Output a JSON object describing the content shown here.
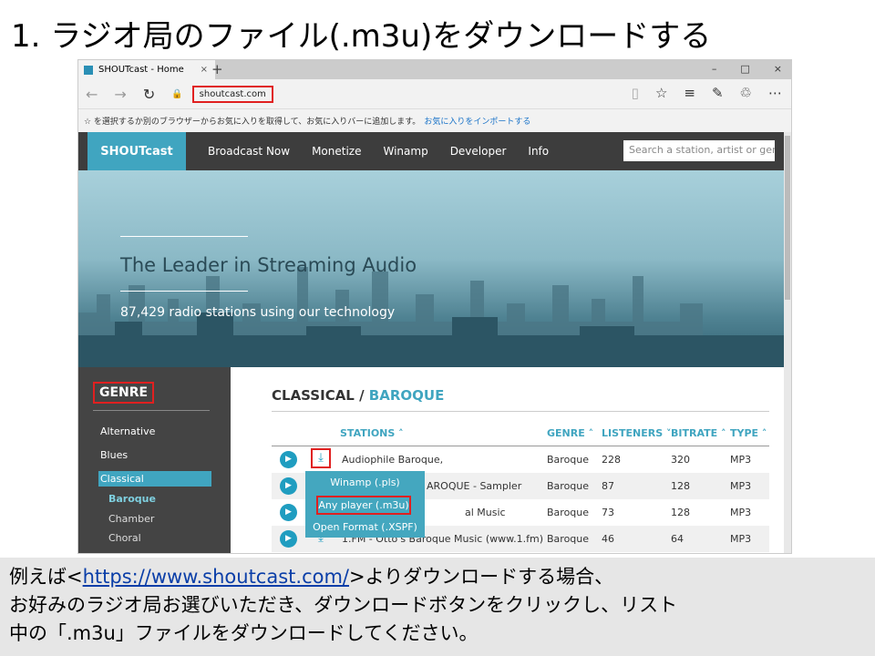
{
  "slide_title": "1. ラジオ局のファイル(.m3u)をダウンロードする",
  "browser": {
    "tab_title": "SHOUTcast - Home",
    "tab_close": "×",
    "new_tab": "+",
    "win_controls": [
      "–",
      "□",
      "×"
    ],
    "nav": {
      "back": "←",
      "forward": "→",
      "refresh": "↻",
      "lock": "🔒"
    },
    "url": "shoutcast.com",
    "tools": [
      "▯",
      "☆",
      "≡",
      "✎",
      "♲",
      "⋯"
    ],
    "favbar_text": "☆ を選択するか別のブラウザーからお気に入りを取得して、お気に入りバーに追加します。",
    "favbar_link": "お気に入りをインポートする"
  },
  "site": {
    "logo": "SHOUTcast",
    "nav": [
      "Broadcast Now",
      "Monetize",
      "Winamp",
      "Developer",
      "Info"
    ],
    "search_placeholder": "Search a station, artist or genre",
    "hero_title": "The Leader in Streaming Audio",
    "hero_sub": "87,429 radio stations using our technology",
    "genre_heading": "GENRE",
    "genres": [
      "Alternative",
      "Blues",
      "Classical"
    ],
    "subgenres": [
      "Baroque",
      "Chamber",
      "Choral"
    ],
    "crumb_parent": "CLASSICAL / ",
    "crumb_current": "BAROQUE",
    "headers": {
      "stations": "STATIONS ˄",
      "genre": "GENRE ˄",
      "listeners": "LISTENERS ˅",
      "bitrate": "BITRATE ˄",
      "type": "TYPE ˄"
    },
    "rows": [
      {
        "name": "Audiophile Baroque,",
        "genre": "Baroque",
        "listeners": "228",
        "bitrate": "320",
        "type": "MP3"
      },
      {
        "name": "AROQUE - Sampler",
        "genre": "Baroque",
        "listeners": "87",
        "bitrate": "128",
        "type": "MP3"
      },
      {
        "name": "al Music",
        "genre": "Baroque",
        "listeners": "73",
        "bitrate": "128",
        "type": "MP3"
      },
      {
        "name": "1.FM - Otto's Baroque Music (www.1.fm)",
        "genre": "Baroque",
        "listeners": "46",
        "bitrate": "64",
        "type": "MP3"
      }
    ],
    "menu": [
      "Winamp (.pls)",
      "Any player (.m3u)",
      "Open Format (.XSPF)"
    ]
  },
  "caption": {
    "pre": "例えば<",
    "link": "https://www.shoutcast.com/",
    "post": ">よりダウンロードする場合、",
    "line2": "お好みのラジオ局お選びいただき、ダウンロードボタンをクリックし、リスト",
    "line3": "中の「.m3u」ファイルをダウンロードしてください。"
  }
}
